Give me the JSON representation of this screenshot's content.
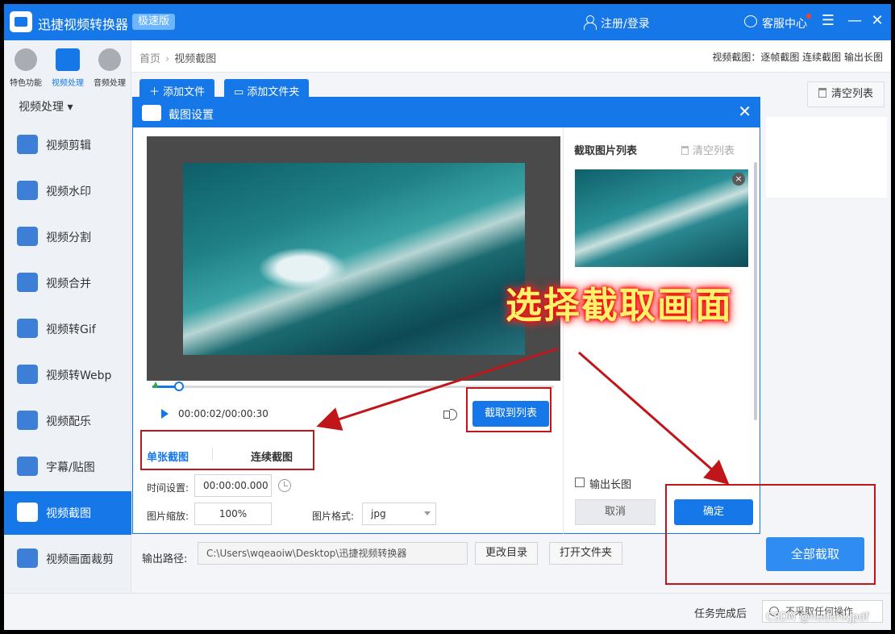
{
  "titlebar": {
    "app_title": "迅捷视频转换器",
    "edition_badge": "极速版",
    "login": "注册/登录",
    "customer_service": "客服中心"
  },
  "sidebar": {
    "top_categories": [
      {
        "label": "特色功能"
      },
      {
        "label": "视频处理"
      },
      {
        "label": "音频处理"
      }
    ],
    "heading": "视频处理",
    "items": [
      {
        "label": "视频剪辑",
        "icon": "video-edit-icon"
      },
      {
        "label": "视频水印",
        "icon": "watermark-icon"
      },
      {
        "label": "视频分割",
        "icon": "split-icon"
      },
      {
        "label": "视频合并",
        "icon": "merge-icon"
      },
      {
        "label": "视频转Gif",
        "icon": "gif-icon"
      },
      {
        "label": "视频转Webp",
        "icon": "webp-icon"
      },
      {
        "label": "视频配乐",
        "icon": "music-icon"
      },
      {
        "label": "字幕/贴图",
        "icon": "sticker-icon"
      },
      {
        "label": "视频截图",
        "icon": "screenshot-icon"
      },
      {
        "label": "视频画面裁剪",
        "icon": "crop-icon"
      }
    ],
    "active_index": 8
  },
  "breadcrumb": {
    "home": "首页",
    "current": "视频截图",
    "right_info": "视频截图：逐帧截图 连续截图 输出长图"
  },
  "toolbar": {
    "add_file": "添加文件",
    "add_folder": "添加文件夹",
    "clear_list": "清空列表"
  },
  "dialog": {
    "title": "截图设置",
    "time_display": "00:00:02/00:00:30",
    "playback_progress": 0.067,
    "capture_button": "截取到列表",
    "modes": {
      "single": "单张截图",
      "continuous": "连续截图"
    },
    "fields": {
      "time_label": "时间设置:",
      "time_value": "00:00:00.000",
      "scale_label": "图片缩放:",
      "scale_value": "100%",
      "format_label": "图片格式:",
      "format_value": "jpg"
    },
    "list_title": "截取图片列表",
    "list_clear": "清空列表",
    "long_image_label": "输出长图",
    "cancel": "取消",
    "confirm": "确定"
  },
  "output": {
    "label": "输出路径:",
    "path": "C:\\Users\\wqeaoiw\\Desktop\\迅捷视频转换器",
    "change_dir": "更改目录",
    "open_folder": "打开文件夹",
    "convert_all": "全部截取"
  },
  "status": {
    "label": "任务完成后",
    "value": "不采取任何操作"
  },
  "annotation": {
    "text": "选择截取画面",
    "color": "#c0161a"
  },
  "watermark": "CSDN @hudunkjpdf",
  "colors": {
    "accent": "#1677e8"
  }
}
